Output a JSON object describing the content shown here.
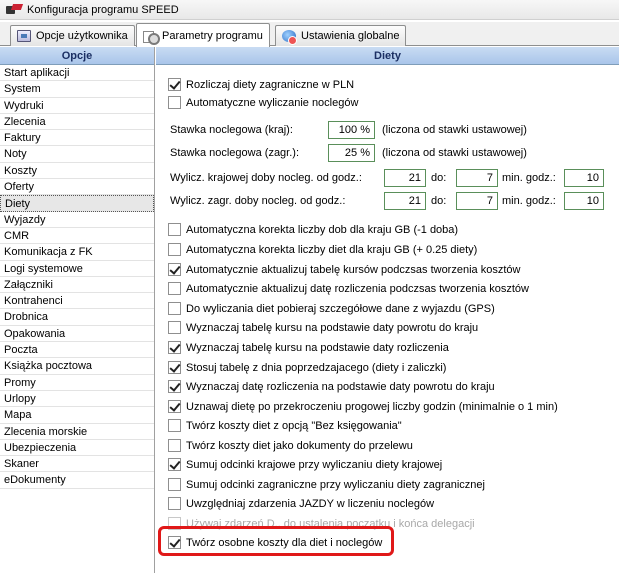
{
  "window": {
    "title": "Konfiguracja programu SPEED"
  },
  "tabs": [
    {
      "label": "Opcje użytkownika"
    },
    {
      "label": "Parametry programu"
    },
    {
      "label": "Ustawienia globalne"
    }
  ],
  "left_panel": {
    "header": "Opcje",
    "items": [
      "Start aplikacji",
      "System",
      "Wydruki",
      "Zlecenia",
      "Faktury",
      "Noty",
      "Koszty",
      "Oferty",
      "Diety",
      "Wyjazdy",
      "CMR",
      "Komunikacja z FK",
      "Logi systemowe",
      "Załączniki",
      "Kontrahenci",
      "Drobnica",
      "Opakowania",
      "Poczta",
      "Książka pocztowa",
      "Promy",
      "Urlopy",
      "Mapa",
      "Zlecenia morskie",
      "Ubezpieczenia",
      "Skaner",
      "eDokumenty"
    ],
    "selected": "Diety"
  },
  "right_panel": {
    "header": "Diety",
    "top_checks": [
      {
        "label": "Rozliczaj diety zagraniczne w PLN",
        "checked": true
      },
      {
        "label": "Automatyczne wyliczanie noclegów",
        "checked": false
      }
    ],
    "stawka_kraj": {
      "label": "Stawka noclegowa (kraj):",
      "value": "100 %",
      "note": "(liczona od stawki ustawowej)"
    },
    "stawka_zagr": {
      "label": "Stawka noclegowa (zagr.):",
      "value": "25 %",
      "note": "(liczona od stawki ustawowej)"
    },
    "doba_kraj": {
      "label": "Wylicz. krajowej doby nocleg. od godz.:",
      "from": "21",
      "do_label": "do:",
      "to": "7",
      "min_label": "min. godz.:",
      "min": "10"
    },
    "doba_zagr": {
      "label": "Wylicz. zagr. doby nocleg. od godz.:",
      "from": "21",
      "do_label": "do:",
      "to": "7",
      "min_label": "min. godz.:",
      "min": "10"
    },
    "checks": [
      {
        "label": "Automatyczna korekta liczby dob dla kraju GB (-1 doba)",
        "checked": false
      },
      {
        "label": "Automatyczna korekta liczby diet dla kraju GB (+ 0.25 diety)",
        "checked": false
      },
      {
        "label": "Automatycznie aktualizuj tabelę kursów podczsas tworzenia kosztów",
        "checked": true
      },
      {
        "label": "Automatycznie aktualizuj datę rozliczenia podczsas tworzenia kosztów",
        "checked": false
      },
      {
        "label": "Do wyliczania diet pobieraj szczegółowe dane z wyjazdu (GPS)",
        "checked": false
      },
      {
        "label": "Wyznaczaj tabelę kursu na podstawie daty powrotu do kraju",
        "checked": false
      },
      {
        "label": "Wyznaczaj tabelę kursu na podstawie daty rozliczenia",
        "checked": true
      },
      {
        "label": "Stosuj tabelę z dnia poprzedzajacego (diety i zaliczki)",
        "checked": true
      },
      {
        "label": "Wyznaczaj datę rozliczenia na podstawie daty powrotu do kraju",
        "checked": true
      },
      {
        "label": "Uznawaj dietę po przekroczeniu progowej liczby godzin (minimalnie o 1 min)",
        "checked": true
      },
      {
        "label": "Twórz koszty diet z opcją \"Bez księgowania\"",
        "checked": false
      },
      {
        "label": "Twórz koszty diet jako dokumenty do przelewu",
        "checked": false
      },
      {
        "label": "Sumuj odcinki krajowe przy wyliczaniu diety krajowej",
        "checked": true
      },
      {
        "label": "Sumuj odcinki zagraniczne przy wyliczaniu diety zagranicznej",
        "checked": false
      },
      {
        "label": "Uwzględniaj zdarzenia JAZDY w liczeniu noclegów",
        "checked": false
      },
      {
        "label": "Używaj zdarzeń D.. do ustalenia początku i końca delegacji",
        "checked": false,
        "disabled": true
      },
      {
        "label": "Twórz osobne koszty dla diet i noclegów",
        "checked": true
      }
    ]
  },
  "colors": {
    "header_blue": "#a9c5ea",
    "highlight_red": "#e01818",
    "field_border": "#5a8f5a"
  }
}
